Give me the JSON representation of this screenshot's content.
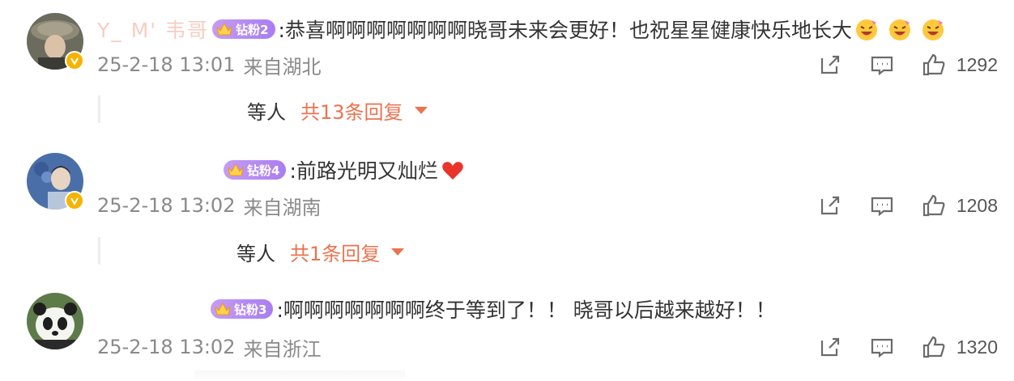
{
  "comments": [
    {
      "username": "Y_  M'  韦哥",
      "fan_badge": "钻粉2",
      "text": ":恭喜啊啊啊啊啊啊啊晓哥未来会更好！也祝星星健康快乐地长大",
      "emoji_count": 3,
      "timestamp": "25-2-18 13:01",
      "location": "来自湖北",
      "likes": "1292",
      "replies_prefix": "等人",
      "replies_label": "共13条回复"
    },
    {
      "username": "",
      "fan_badge": "钻粉4",
      "text": ":前路光明又灿烂",
      "emoji": "heart",
      "timestamp": "25-2-18 13:02",
      "location": "来自湖南",
      "likes": "1208",
      "replies_prefix": "等人",
      "replies_label": "共1条回复"
    },
    {
      "username": "",
      "fan_badge": "钻粉3",
      "text": ":啊啊啊啊啊啊啊终于等到了！！ 晓哥以后越来越好！！",
      "timestamp": "25-2-18 13:02",
      "location": "来自浙江",
      "likes": "1320"
    }
  ],
  "icons": {
    "share": "share-icon",
    "reply": "comment-icon",
    "like": "thumbs-up-icon",
    "verified": "verified-v-icon",
    "expand": "caret-down-icon"
  },
  "colors": {
    "accent": "#eb7350",
    "meta": "#8a8a8a",
    "badge": "#b48cf2",
    "verified": "#f5b400"
  }
}
